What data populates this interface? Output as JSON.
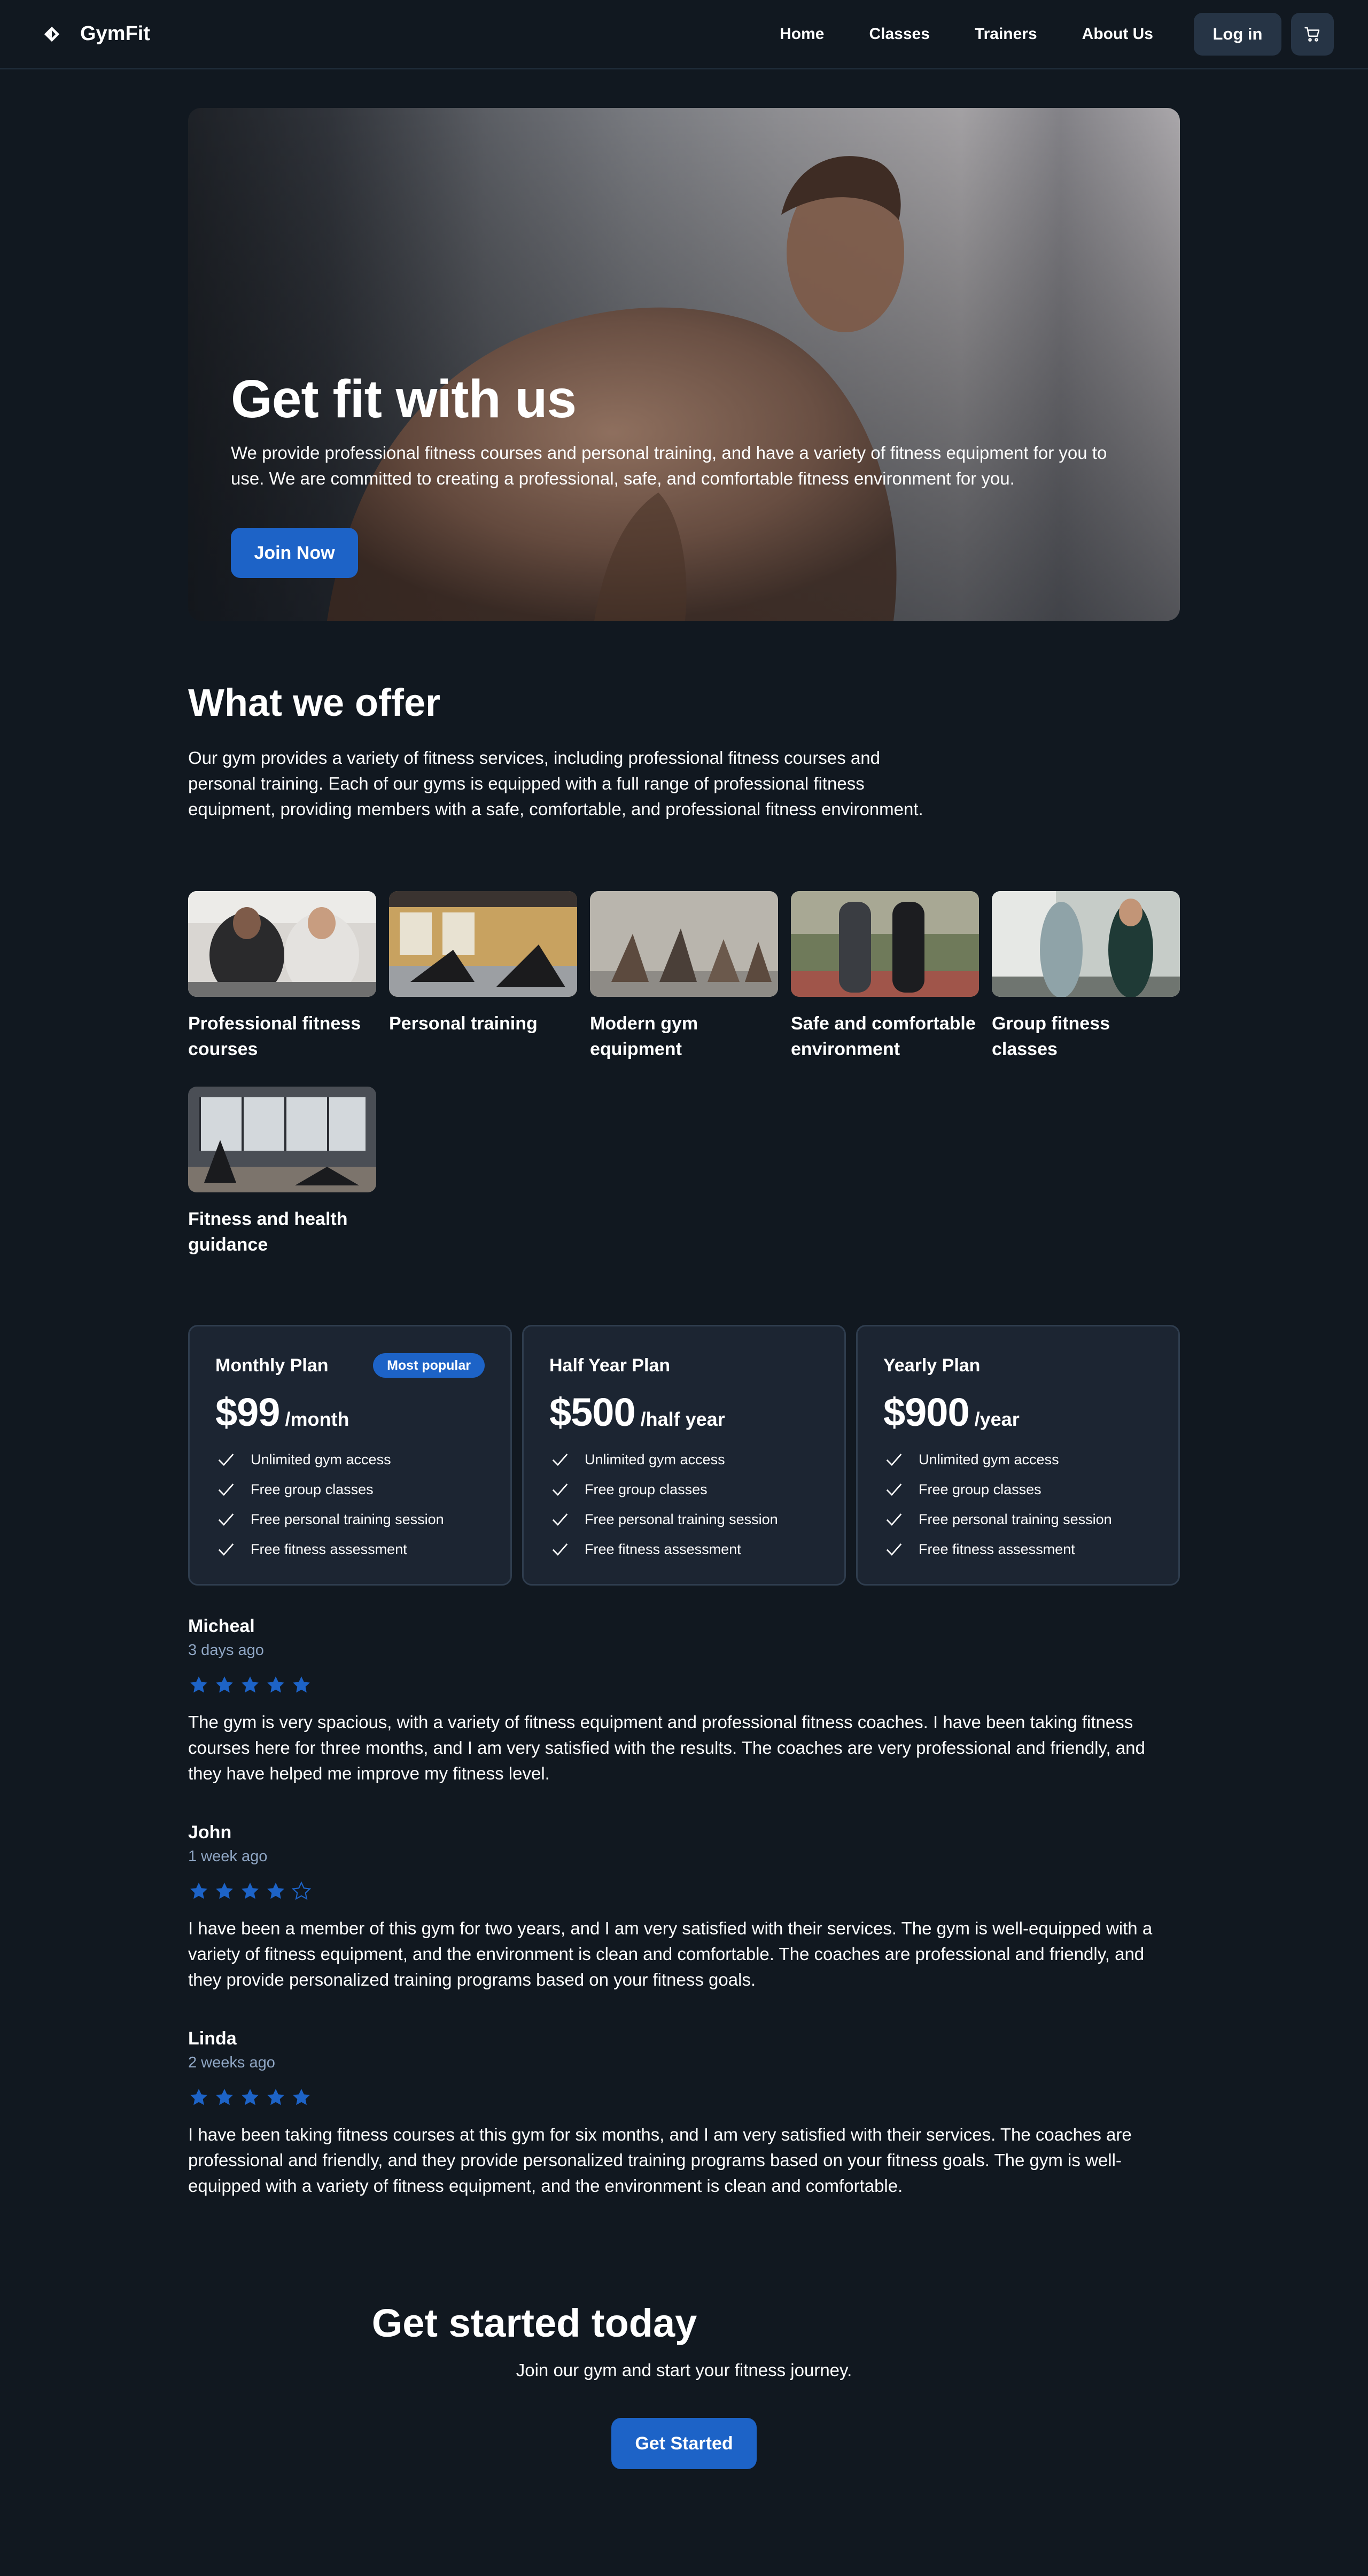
{
  "header": {
    "brand": "GymFit",
    "nav": [
      "Home",
      "Classes",
      "Trainers",
      "About Us"
    ],
    "login_label": "Log in",
    "icons": {
      "logo": "diamond-logo-icon",
      "cart": "cart-icon"
    }
  },
  "hero": {
    "title": "Get fit with us",
    "description": "We provide professional fitness courses and personal training, and have a variety of fitness equipment for you to use. We are committed to creating a professional, safe, and comfortable fitness environment for you.",
    "cta_label": "Join Now"
  },
  "offer": {
    "title": "What we offer",
    "description": "Our gym provides a variety of fitness services, including professional fitness courses and personal training. Each of our gyms is equipped with a full range of professional fitness equipment, providing members with a safe, comfortable, and professional fitness environment.",
    "items": [
      {
        "label": "Professional fitness courses"
      },
      {
        "label": "Personal training"
      },
      {
        "label": "Modern gym equipment"
      },
      {
        "label": "Safe and comfortable environment"
      },
      {
        "label": "Group fitness classes"
      },
      {
        "label": "Fitness and health guidance"
      }
    ]
  },
  "plans": [
    {
      "name": "Monthly Plan",
      "badge": "Most popular",
      "price": "$99",
      "unit": "/month",
      "features": [
        "Unlimited gym access",
        "Free group classes",
        "Free personal training session",
        "Free fitness assessment"
      ]
    },
    {
      "name": "Half Year Plan",
      "badge": "",
      "price": "$500",
      "unit": "/half year",
      "features": [
        "Unlimited gym access",
        "Free group classes",
        "Free personal training session",
        "Free fitness assessment"
      ]
    },
    {
      "name": "Yearly Plan",
      "badge": "",
      "price": "$900",
      "unit": "/year",
      "features": [
        "Unlimited gym access",
        "Free group classes",
        "Free personal training session",
        "Free fitness assessment"
      ]
    }
  ],
  "reviews": [
    {
      "name": "Micheal",
      "time": "3 days ago",
      "rating": 5,
      "text": "The gym is very spacious, with a variety of fitness equipment and professional fitness coaches. I have been taking fitness courses here for three months, and I am very satisfied with the results. The coaches are very professional and friendly, and they have helped me improve my fitness level."
    },
    {
      "name": "John",
      "time": "1 week ago",
      "rating": 4,
      "text": "I have been a member of this gym for two years, and I am very satisfied with their services. The gym is well-equipped with a variety of fitness equipment, and the environment is clean and comfortable. The coaches are professional and friendly, and they provide personalized training programs based on your fitness goals."
    },
    {
      "name": "Linda",
      "time": "2 weeks ago",
      "rating": 5,
      "text": "I have been taking fitness courses at this gym for six months, and I am very satisfied with their services. The coaches are professional and friendly, and they provide personalized training programs based on your fitness goals. The gym is well-equipped with a variety of fitness equipment, and the environment is clean and comfortable."
    }
  ],
  "cta": {
    "title": "Get started today",
    "description": "Join our gym and start your fitness journey.",
    "button_label": "Get Started"
  },
  "colors": {
    "background": "#111820",
    "accent": "#1d63c7",
    "card": "#1c2532",
    "star": "#1d63c7"
  }
}
